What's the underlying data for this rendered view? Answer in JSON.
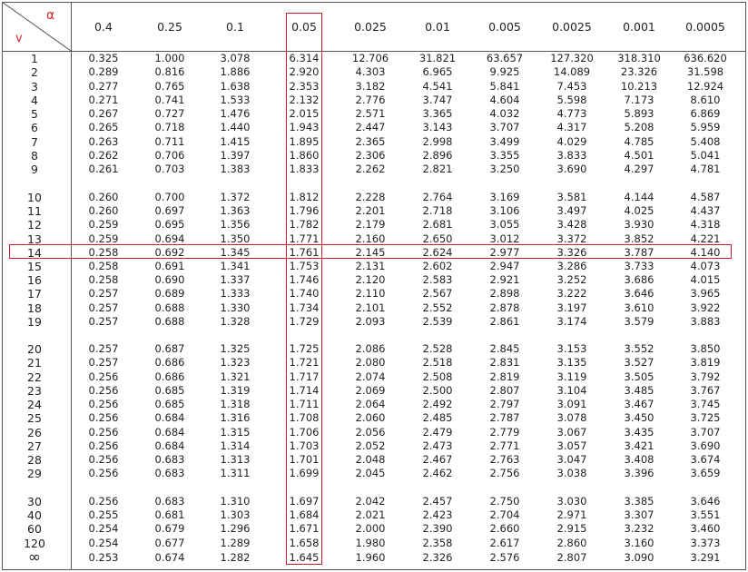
{
  "corner": {
    "alpha_label": "α",
    "nu_label": "v"
  },
  "alpha_headers": [
    "0.4",
    "0.25",
    "0.1",
    "0.05",
    "0.025",
    "0.01",
    "0.005",
    "0.0025",
    "0.001",
    "0.0005"
  ],
  "rows": [
    {
      "df": "1",
      "values": [
        "0.325",
        "1.000",
        "3.078",
        "6.314",
        "12.706",
        "31.821",
        "63.657",
        "127.320",
        "318.310",
        "636.620"
      ]
    },
    {
      "df": "2",
      "values": [
        "0.289",
        "0.816",
        "1.886",
        "2.920",
        "4.303",
        "6.965",
        "9.925",
        "14.089",
        "23.326",
        "31.598"
      ]
    },
    {
      "df": "3",
      "values": [
        "0.277",
        "0.765",
        "1.638",
        "2.353",
        "3.182",
        "4.541",
        "5.841",
        "7.453",
        "10.213",
        "12.924"
      ]
    },
    {
      "df": "4",
      "values": [
        "0.271",
        "0.741",
        "1.533",
        "2.132",
        "2.776",
        "3.747",
        "4.604",
        "5.598",
        "7.173",
        "8.610"
      ]
    },
    {
      "df": "5",
      "values": [
        "0.267",
        "0.727",
        "1.476",
        "2.015",
        "2.571",
        "3.365",
        "4.032",
        "4.773",
        "5.893",
        "6.869"
      ]
    },
    {
      "df": "6",
      "values": [
        "0.265",
        "0.718",
        "1.440",
        "1.943",
        "2.447",
        "3.143",
        "3.707",
        "4.317",
        "5.208",
        "5.959"
      ]
    },
    {
      "df": "7",
      "values": [
        "0.263",
        "0.711",
        "1.415",
        "1.895",
        "2.365",
        "2.998",
        "3.499",
        "4.029",
        "4.785",
        "5.408"
      ]
    },
    {
      "df": "8",
      "values": [
        "0.262",
        "0.706",
        "1.397",
        "1.860",
        "2.306",
        "2.896",
        "3.355",
        "3.833",
        "4.501",
        "5.041"
      ]
    },
    {
      "df": "9",
      "values": [
        "0.261",
        "0.703",
        "1.383",
        "1.833",
        "2.262",
        "2.821",
        "3.250",
        "3.690",
        "4.297",
        "4.781"
      ]
    },
    {
      "df": "10",
      "values": [
        "0.260",
        "0.700",
        "1.372",
        "1.812",
        "2.228",
        "2.764",
        "3.169",
        "3.581",
        "4.144",
        "4.587"
      ]
    },
    {
      "df": "11",
      "values": [
        "0.260",
        "0.697",
        "1.363",
        "1.796",
        "2.201",
        "2.718",
        "3.106",
        "3.497",
        "4.025",
        "4.437"
      ]
    },
    {
      "df": "12",
      "values": [
        "0.259",
        "0.695",
        "1.356",
        "1.782",
        "2.179",
        "2.681",
        "3.055",
        "3.428",
        "3.930",
        "4.318"
      ]
    },
    {
      "df": "13",
      "values": [
        "0.259",
        "0.694",
        "1.350",
        "1.771",
        "2.160",
        "2.650",
        "3.012",
        "3.372",
        "3.852",
        "4.221"
      ]
    },
    {
      "df": "14",
      "values": [
        "0.258",
        "0.692",
        "1.345",
        "1.761",
        "2.145",
        "2.624",
        "2.977",
        "3.326",
        "3.787",
        "4.140"
      ]
    },
    {
      "df": "15",
      "values": [
        "0.258",
        "0.691",
        "1.341",
        "1.753",
        "2.131",
        "2.602",
        "2.947",
        "3.286",
        "3.733",
        "4.073"
      ]
    },
    {
      "df": "16",
      "values": [
        "0.258",
        "0.690",
        "1.337",
        "1.746",
        "2.120",
        "2.583",
        "2.921",
        "3.252",
        "3.686",
        "4.015"
      ]
    },
    {
      "df": "17",
      "values": [
        "0.257",
        "0.689",
        "1.333",
        "1.740",
        "2.110",
        "2.567",
        "2.898",
        "3.222",
        "3.646",
        "3.965"
      ]
    },
    {
      "df": "18",
      "values": [
        "0.257",
        "0.688",
        "1.330",
        "1.734",
        "2.101",
        "2.552",
        "2.878",
        "3.197",
        "3.610",
        "3.922"
      ]
    },
    {
      "df": "19",
      "values": [
        "0.257",
        "0.688",
        "1.328",
        "1.729",
        "2.093",
        "2.539",
        "2.861",
        "3.174",
        "3.579",
        "3.883"
      ]
    },
    {
      "df": "20",
      "values": [
        "0.257",
        "0.687",
        "1.325",
        "1.725",
        "2.086",
        "2.528",
        "2.845",
        "3.153",
        "3.552",
        "3.850"
      ]
    },
    {
      "df": "21",
      "values": [
        "0.257",
        "0.686",
        "1.323",
        "1.721",
        "2.080",
        "2.518",
        "2.831",
        "3.135",
        "3.527",
        "3.819"
      ]
    },
    {
      "df": "22",
      "values": [
        "0.256",
        "0.686",
        "1.321",
        "1.717",
        "2.074",
        "2.508",
        "2.819",
        "3.119",
        "3.505",
        "3.792"
      ]
    },
    {
      "df": "23",
      "values": [
        "0.256",
        "0.685",
        "1.319",
        "1.714",
        "2.069",
        "2.500",
        "2.807",
        "3.104",
        "3.485",
        "3.767"
      ]
    },
    {
      "df": "24",
      "values": [
        "0.256",
        "0.685",
        "1.318",
        "1.711",
        "2.064",
        "2.492",
        "2.797",
        "3.091",
        "3.467",
        "3.745"
      ]
    },
    {
      "df": "25",
      "values": [
        "0.256",
        "0.684",
        "1.316",
        "1.708",
        "2.060",
        "2.485",
        "2.787",
        "3.078",
        "3.450",
        "3.725"
      ]
    },
    {
      "df": "26",
      "values": [
        "0.256",
        "0.684",
        "1.315",
        "1.706",
        "2.056",
        "2.479",
        "2.779",
        "3.067",
        "3.435",
        "3.707"
      ]
    },
    {
      "df": "27",
      "values": [
        "0.256",
        "0.684",
        "1.314",
        "1.703",
        "2.052",
        "2.473",
        "2.771",
        "3.057",
        "3.421",
        "3.690"
      ]
    },
    {
      "df": "28",
      "values": [
        "0.256",
        "0.683",
        "1.313",
        "1.701",
        "2.048",
        "2.467",
        "2.763",
        "3.047",
        "3.408",
        "3.674"
      ]
    },
    {
      "df": "29",
      "values": [
        "0.256",
        "0.683",
        "1.311",
        "1.699",
        "2.045",
        "2.462",
        "2.756",
        "3.038",
        "3.396",
        "3.659"
      ]
    },
    {
      "df": "30",
      "values": [
        "0.256",
        "0.683",
        "1.310",
        "1.697",
        "2.042",
        "2.457",
        "2.750",
        "3.030",
        "3.385",
        "3.646"
      ]
    },
    {
      "df": "40",
      "values": [
        "0.255",
        "0.681",
        "1.303",
        "1.684",
        "2.021",
        "2.423",
        "2.704",
        "2.971",
        "3.307",
        "3.551"
      ]
    },
    {
      "df": "60",
      "values": [
        "0.254",
        "0.679",
        "1.296",
        "1.671",
        "2.000",
        "2.390",
        "2.660",
        "2.915",
        "3.232",
        "3.460"
      ]
    },
    {
      "df": "120",
      "values": [
        "0.254",
        "0.677",
        "1.289",
        "1.658",
        "1.980",
        "2.358",
        "2.617",
        "2.860",
        "3.160",
        "3.373"
      ]
    },
    {
      "df": "∞",
      "values": [
        "0.253",
        "0.674",
        "1.282",
        "1.645",
        "1.960",
        "2.326",
        "2.576",
        "2.807",
        "3.090",
        "3.291"
      ]
    }
  ],
  "highlight": {
    "column_alpha": "0.05",
    "row_df": "14",
    "color": "#c8202a"
  },
  "colors": {
    "label_red": "#d4262a",
    "grid": "#555555"
  }
}
